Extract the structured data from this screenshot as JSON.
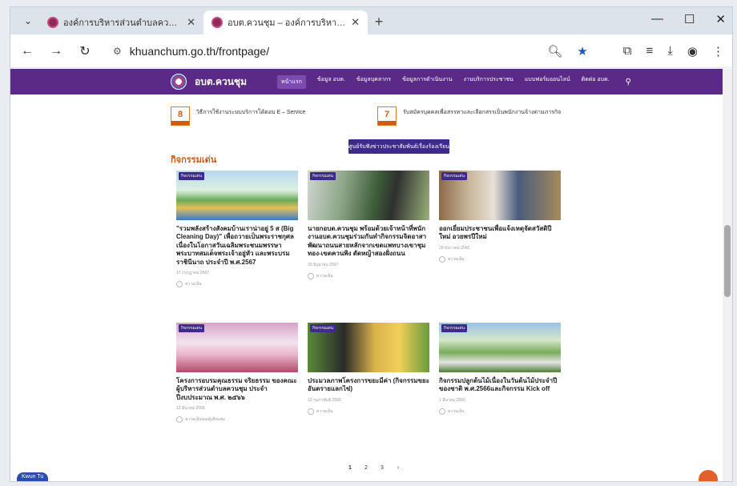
{
  "browser": {
    "tabs": [
      {
        "title": "องค์การบริหารส่วนตำบลควนชุม – อ",
        "active": false
      },
      {
        "title": "อบต.ควนชุม – องค์การบริหารส่วนต",
        "active": true
      }
    ],
    "url": "khuanchum.go.th/frontpage/",
    "new_tab_label": "+",
    "close_label": "✕"
  },
  "site": {
    "brand": "อบต.ควนชุม",
    "menu": [
      "หน้าแรก",
      "ข้อมูล อบต.",
      "ข้อมูลบุคลากร",
      "ข้อมูลการดำเนินงาน",
      "งานบริการประชาชน",
      "แบบฟอร์มออนไลน์",
      "ติดต่อ อบต."
    ],
    "services": [
      {
        "count": "8",
        "label": "วิธีการใช้งานระบบบริการโต้ตอบ E – Service"
      },
      {
        "count": "7",
        "label": "รับสมัครบุคคลเพื่อสรรหาและเลือกสรรเป็นพนักงานจ้างตามภารกิจ"
      }
    ],
    "complaint_button": "ศูนย์รับฟังข่าวประชาสัมพันธ์เรื่องร้องเรียน",
    "section_title": "กิจกรรมเด่น",
    "category": "กิจกรรมเด่น",
    "cards": [
      {
        "title": "\"รวมพลังสร้างสังคมบ้านเราน่าอยู่ 5 ส (Big Cleaning Day)\" เพื่อถวายเป็นพระราชกุศลเนื่องในโอกาสวันเฉลิมพระชนมพรรษา พระบาทสมเด็จพระเจ้าอยู่หัว และพระบรมราชินีนาถ ประจำปี พ.ศ.2567",
        "date": "17 กรกฎาคม 2567",
        "comments": "ความเห็น"
      },
      {
        "title": "นายกอบต.ควนชุม พร้อมด้วยเจ้าหน้าที่พนักงานอบต.ควนชุมร่วมกันทำกิจกรรมจิตอาสาพัฒนาถนนสายหลักจากเขตแพทบางเขาชุมทอง-เขตควนพิง ตัดหญ้าสองฝั่งถนน",
        "date": "29 มิถุนายน 2567",
        "comments": "ความเห็น"
      },
      {
        "title": "ออกเยี่ยมประชาชนเพื่อแจ้งเหตุจัดสวัสดิปีใหม่ อวยพรปีใหม่",
        "date": "29 ธันวาคม 2566",
        "comments": "ความเห็น"
      },
      {
        "title": "โครงการอบรมคุณธรรม จริยธรรม ของคณะผู้บริหารส่วนตำบลควนชุม ประจำปีงบประมาณ พ.ศ. ๒๕๖๖",
        "date": "13 มีนาคม 2566",
        "comments": "ความเห็นของผู้เยี่ยมชม"
      },
      {
        "title": "ประมวลภาพโครงการขยะมีค่า (กิจกรรมขยะอันตรายแลกไข่)",
        "date": "13 กุมภาพันธ์ 2566",
        "comments": "ความเห็น"
      },
      {
        "title": "กิจกรรมปลูกต้นไม้เนื่องในวันต้นไม้ประจำปีของชาติ พ.ศ.2566และกิจกรรม Kick off",
        "date": "1 มีนาคม 2566",
        "comments": "ความเห็น"
      }
    ],
    "pages": [
      "1",
      "2",
      "3",
      "›"
    ],
    "chat_label": "Kwun Tu"
  }
}
